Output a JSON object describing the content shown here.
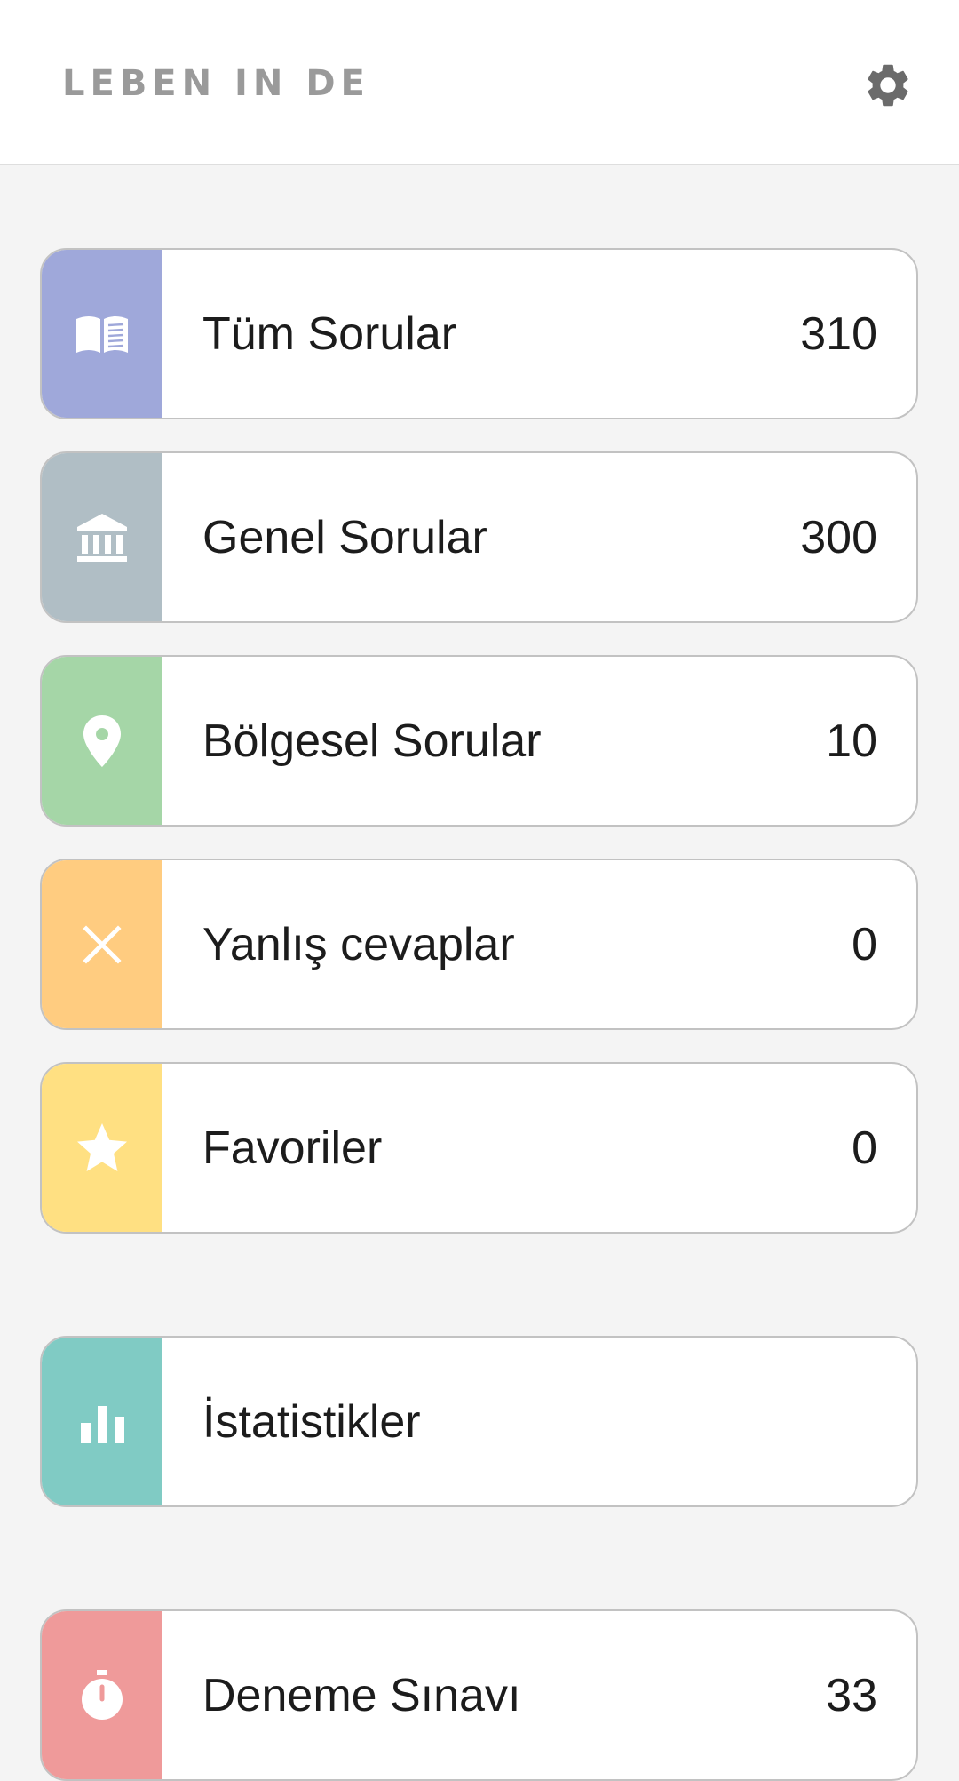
{
  "header": {
    "title": "LEBEN IN DE",
    "settings_icon": "gear-icon"
  },
  "colors": {
    "all_questions": "#9fa8da",
    "general_questions": "#b0bec5",
    "regional_questions": "#a5d6a7",
    "wrong_answers": "#ffcc80",
    "favorites": "#ffe082",
    "statistics": "#80cbc4",
    "practice_exam": "#ef9a9a"
  },
  "categories": [
    {
      "label": "Tüm Sorular",
      "count": "310",
      "icon": "open-book-icon"
    },
    {
      "label": "Genel Sorular",
      "count": "300",
      "icon": "bank-icon"
    },
    {
      "label": "Bölgesel Sorular",
      "count": "10",
      "icon": "map-pin-icon"
    },
    {
      "label": "Yanlış cevaplar",
      "count": "0",
      "icon": "close-icon"
    },
    {
      "label": "Favoriler",
      "count": "0",
      "icon": "star-icon"
    }
  ],
  "statistics": {
    "label": "İstatistikler",
    "icon": "bar-chart-icon"
  },
  "exam": {
    "label": "Deneme Sınavı",
    "count": "33",
    "icon": "stopwatch-icon"
  }
}
